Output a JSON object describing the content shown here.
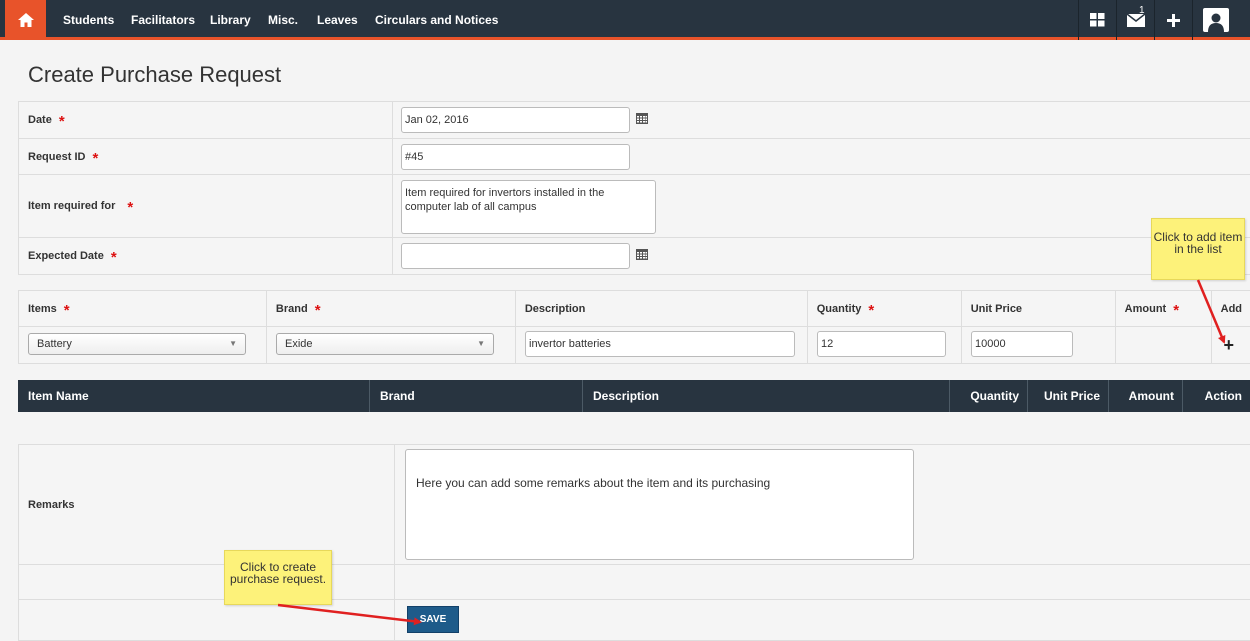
{
  "nav": {
    "items": [
      "Students",
      "Facilitators",
      "Library",
      "Misc.",
      "Leaves",
      "Circulars and Notices"
    ],
    "mail_count": "1"
  },
  "page": {
    "title": "Create Purchase Request"
  },
  "form": {
    "date_label": "Date",
    "date_value": "Jan 02, 2016",
    "request_id_label": "Request ID",
    "request_id_value": "#45",
    "item_required_label": "Item required for",
    "item_required_value": "Item required for invertors installed in the computer lab of all campus",
    "expected_date_label": "Expected Date",
    "expected_date_value": "",
    "required_marker": "*"
  },
  "items_form": {
    "headers": {
      "items": "Items",
      "brand": "Brand",
      "description": "Description",
      "quantity": "Quantity",
      "unit_price": "Unit Price",
      "amount": "Amount",
      "add": "Add"
    },
    "item_value": "Battery",
    "brand_value": "Exide",
    "description_value": "invertor batteries",
    "quantity_value": "12",
    "unit_price_value": "10000",
    "amount_value": "",
    "add_symbol": "+"
  },
  "item_list": {
    "columns": [
      "Item Name",
      "Brand",
      "Description",
      "Quantity",
      "Unit Price",
      "Amount",
      "Action"
    ]
  },
  "remarks": {
    "label": "Remarks",
    "value": "Here you can add some remarks about the item and its purchasing"
  },
  "save_label": "SAVE",
  "callouts": {
    "add_item": "Click to add item in the list",
    "create": "Click to create purchase request."
  },
  "colors": {
    "nav_bg": "#283440",
    "accent": "#e8532a",
    "save_bg": "#1e5b8a",
    "callout_bg": "#fdf27a",
    "arrow": "#e02020"
  }
}
